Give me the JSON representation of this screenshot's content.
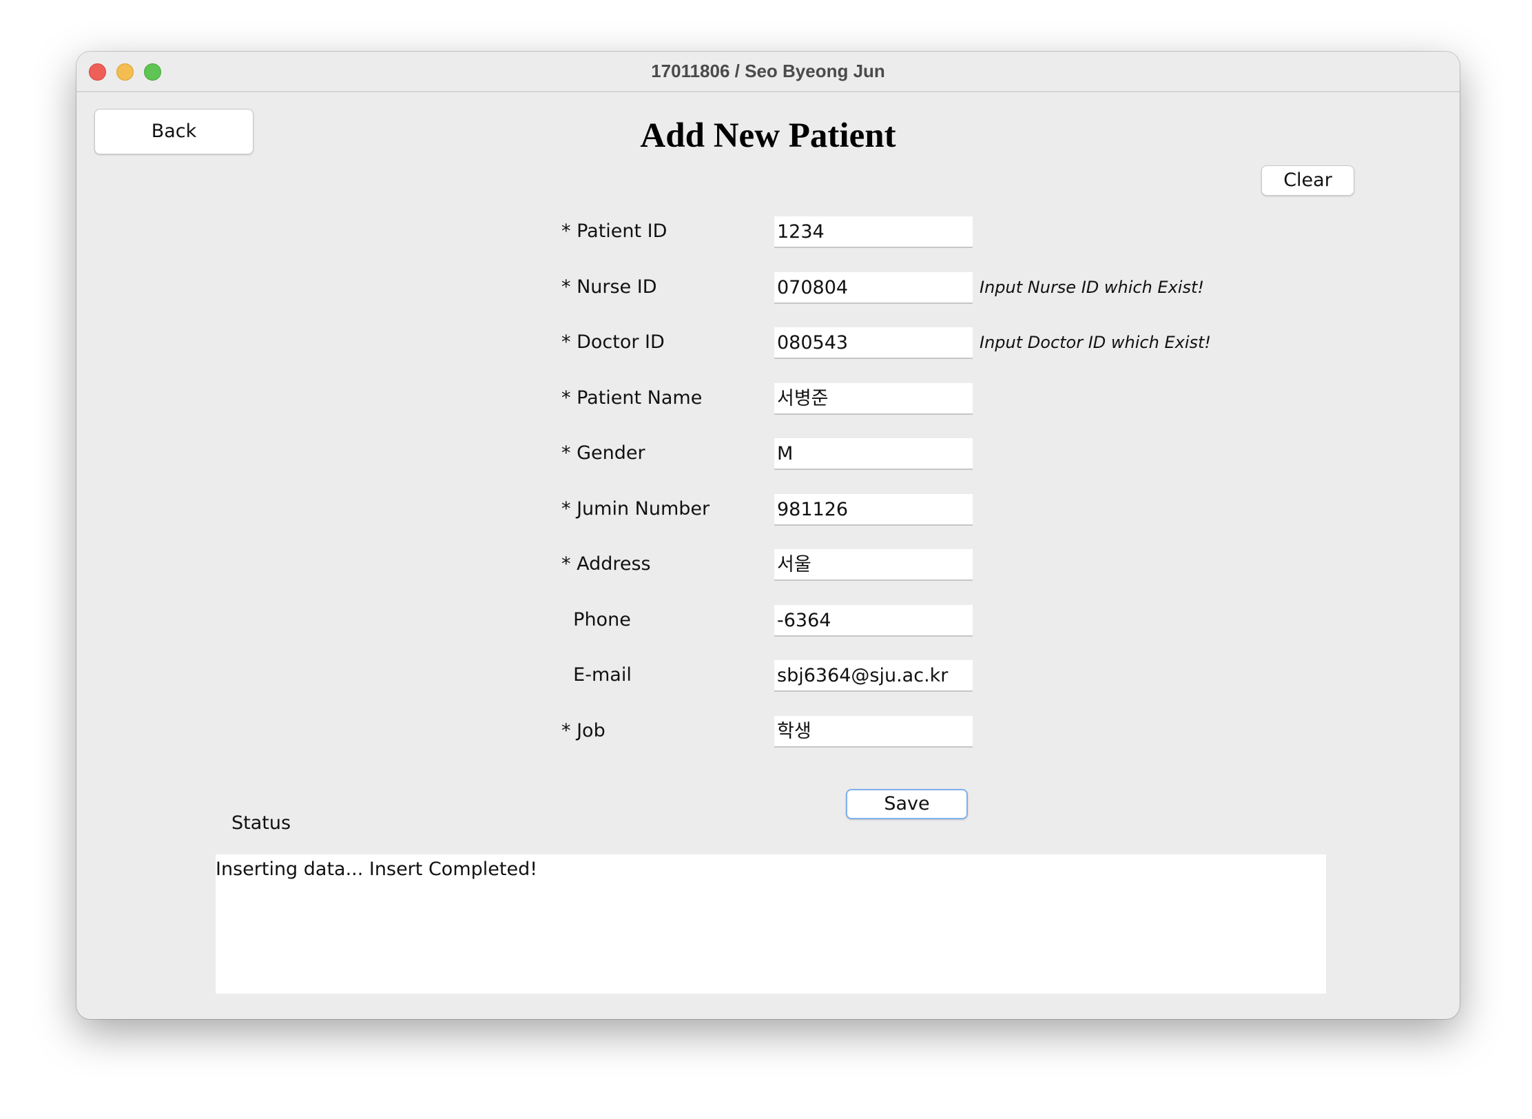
{
  "window": {
    "title": "17011806 / Seo Byeong Jun"
  },
  "header": {
    "back_label": "Back",
    "page_title": "Add New Patient",
    "clear_label": "Clear"
  },
  "form": {
    "fields": [
      {
        "label": "* Patient ID",
        "value": "1234",
        "hint": ""
      },
      {
        "label": "* Nurse ID",
        "value": "070804",
        "hint": "Input Nurse ID which Exist!"
      },
      {
        "label": "* Doctor ID",
        "value": "080543",
        "hint": "Input Doctor ID which Exist!"
      },
      {
        "label": "* Patient Name",
        "value": "서병준",
        "hint": ""
      },
      {
        "label": "* Gender",
        "value": "M",
        "hint": ""
      },
      {
        "label": "* Jumin Number",
        "value": "981126",
        "hint": ""
      },
      {
        "label": "* Address",
        "value": "서울",
        "hint": ""
      },
      {
        "label": "  Phone",
        "value": "-6364",
        "hint": ""
      },
      {
        "label": "  E-mail",
        "value": "sbj6364@sju.ac.kr",
        "hint": ""
      },
      {
        "label": "* Job",
        "value": "학생",
        "hint": ""
      }
    ],
    "save_label": "Save"
  },
  "status": {
    "label": "Status",
    "text": "Inserting data... Insert Completed!"
  },
  "colors": {
    "window_bg": "#ececec",
    "close": "#ee5f57",
    "minimize": "#f4bd4f",
    "maximize": "#5fc454",
    "save_border": "#7fb0ee"
  }
}
